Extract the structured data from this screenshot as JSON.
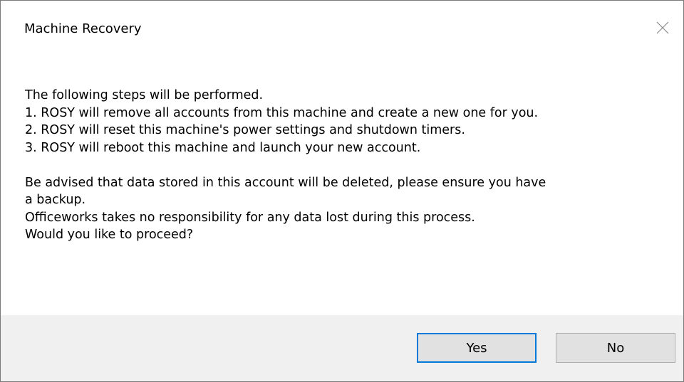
{
  "dialog": {
    "title": "Machine Recovery",
    "close_icon": "close-icon",
    "message": {
      "intro": "The following steps will be performed.",
      "steps": [
        "1. ROSY will remove all accounts from this machine and create a new one for you.",
        "2. ROSY will reset this machine's power settings and shutdown timers.",
        "3. ROSY will reboot this machine and launch your new account."
      ],
      "warning_line1": "Be advised that data stored in this account will be deleted, please ensure you have",
      "warning_line2": "a backup.",
      "disclaimer": "Officeworks takes no responsibility for any data lost during this process.",
      "question": "Would you like to proceed?"
    },
    "buttons": {
      "yes_label": "Yes",
      "no_label": "No"
    },
    "colors": {
      "footer_bg": "#f0f0f0",
      "default_button_border": "#0078d7",
      "button_bg": "#e1e1e1"
    }
  }
}
